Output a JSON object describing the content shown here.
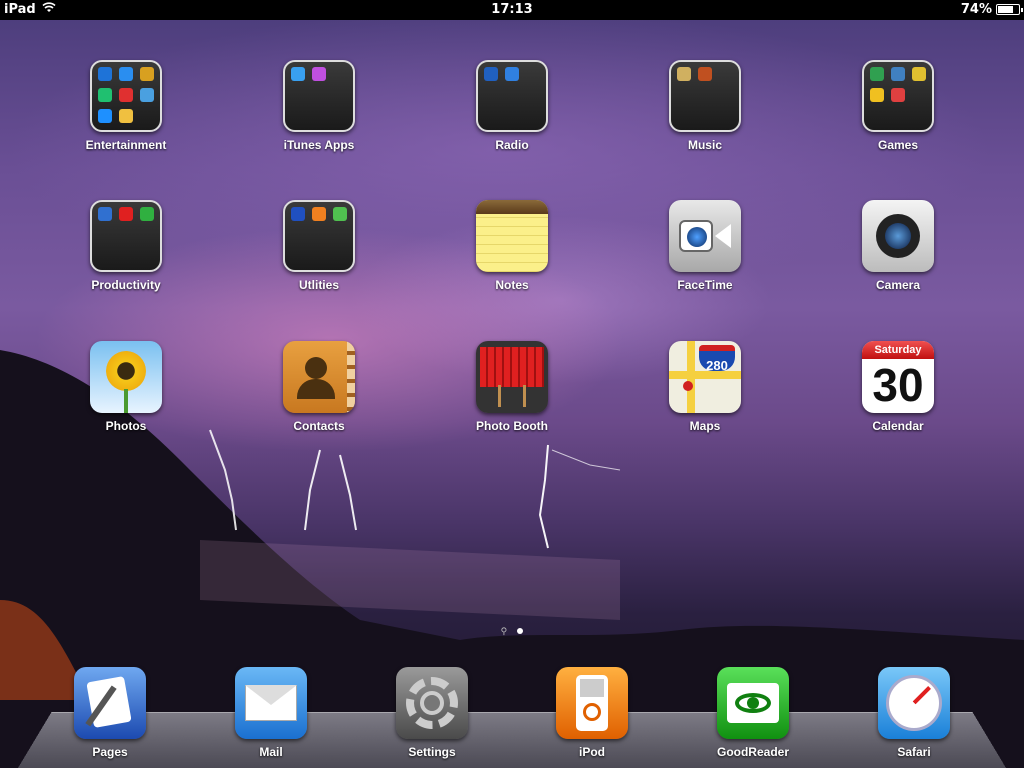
{
  "statusbar": {
    "device": "iPad",
    "time": "17:13",
    "battery": "74%",
    "battery_level": 0.74
  },
  "home": {
    "rows": [
      [
        {
          "label": "Entertainment",
          "kind": "folder",
          "minis": [
            "#1e73d8",
            "#2a8ef0",
            "#d8a020",
            "#20c070",
            "#e03030",
            "#4aa0e0",
            "#1e90ff",
            "#f0c040"
          ]
        },
        {
          "label": "iTunes Apps",
          "kind": "folder",
          "minis": [
            "#39a0f0",
            "#c050e0"
          ]
        },
        {
          "label": "Radio",
          "kind": "folder",
          "minis": [
            "#2060c0",
            "#3080e0"
          ]
        },
        {
          "label": "Music",
          "kind": "folder",
          "minis": [
            "#d0b060",
            "#c05020"
          ]
        },
        {
          "label": "Games",
          "kind": "folder",
          "minis": [
            "#30a050",
            "#4080c0",
            "#e0c030",
            "#f0c020",
            "#e04040"
          ]
        }
      ],
      [
        {
          "label": "Productivity",
          "kind": "folder",
          "minis": [
            "#3070d0",
            "#e02020",
            "#30b040"
          ]
        },
        {
          "label": "Utlities",
          "kind": "folder",
          "minis": [
            "#2050c0",
            "#f08020",
            "#50c050"
          ]
        },
        {
          "label": "Notes",
          "kind": "notes"
        },
        {
          "label": "FaceTime",
          "kind": "facetime"
        },
        {
          "label": "Camera",
          "kind": "camera"
        }
      ],
      [
        {
          "label": "Photos",
          "kind": "photos"
        },
        {
          "label": "Contacts",
          "kind": "contacts"
        },
        {
          "label": "Photo Booth",
          "kind": "photobooth"
        },
        {
          "label": "Maps",
          "kind": "maps",
          "badge": "280"
        },
        {
          "label": "Calendar",
          "kind": "calendar",
          "day_name": "Saturday",
          "day_number": "30"
        }
      ]
    ]
  },
  "dock": [
    {
      "label": "Pages",
      "kind": "pages"
    },
    {
      "label": "Mail",
      "kind": "mail"
    },
    {
      "label": "Settings",
      "kind": "settings"
    },
    {
      "label": "iPod",
      "kind": "ipod"
    },
    {
      "label": "GoodReader",
      "kind": "goodreader"
    },
    {
      "label": "Safari",
      "kind": "safari"
    }
  ],
  "page_indicator": {
    "pages": 2,
    "current": 1
  }
}
